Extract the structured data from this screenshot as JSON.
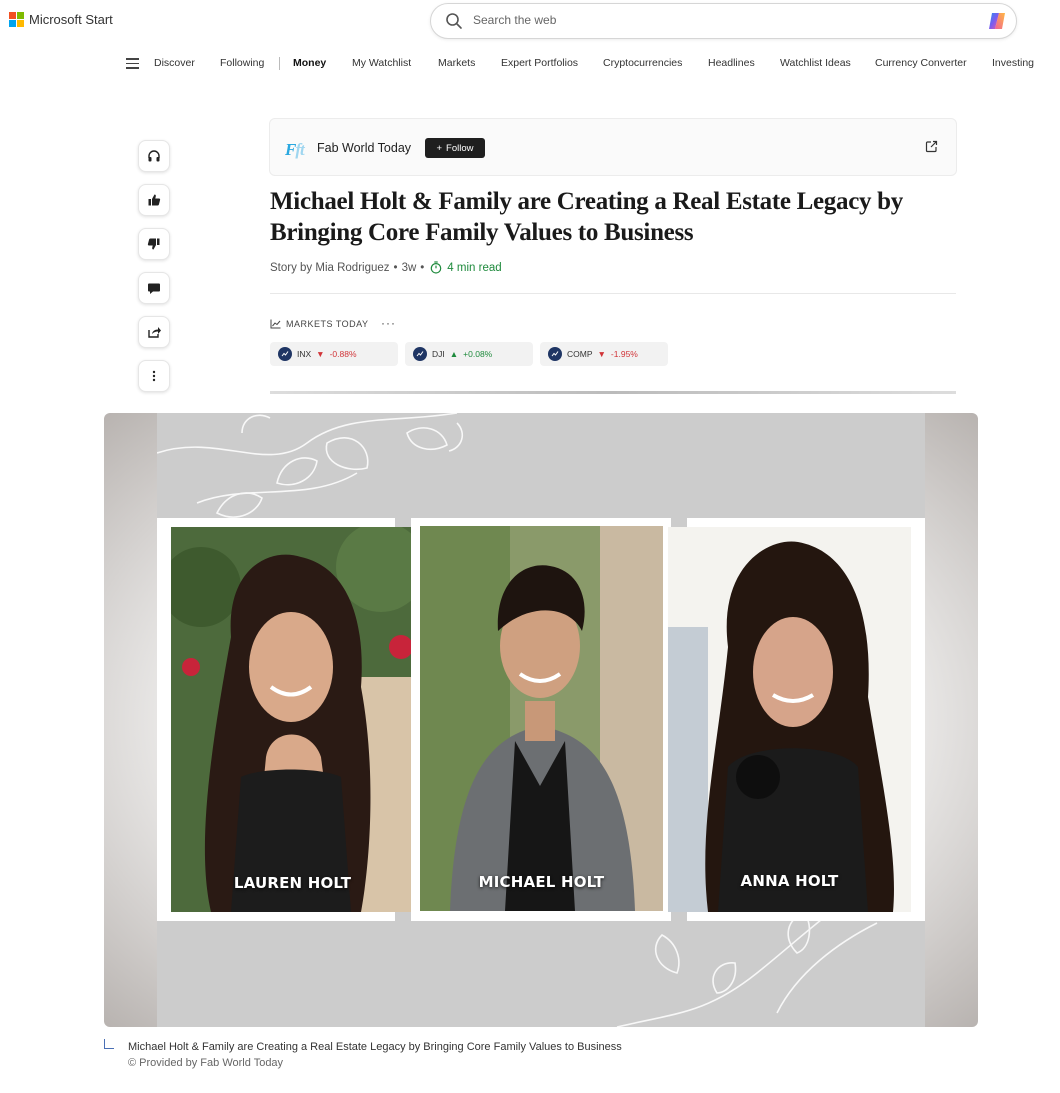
{
  "header": {
    "brand": "Microsoft Start",
    "search_placeholder": "Search the web"
  },
  "nav": {
    "items": [
      "Discover",
      "Following",
      "Money",
      "My Watchlist",
      "Markets",
      "Expert Portfolios",
      "Cryptocurrencies",
      "Headlines",
      "Watchlist Ideas",
      "Currency Converter",
      "Investing"
    ],
    "active": "Money"
  },
  "rail": {
    "buttons": [
      "headphones-icon",
      "thumbs-up-icon",
      "thumbs-down-icon",
      "comment-icon",
      "share-icon",
      "more-vertical-icon"
    ]
  },
  "publisher": {
    "logo_text": "F",
    "logo_text_2": "ft",
    "name": "Fab World Today",
    "follow_label": "Follow",
    "follow_plus": "+"
  },
  "article": {
    "headline": "Michael Holt & Family are Creating a Real Estate Legacy by Bringing Core Family Values to Business",
    "byline_prefix": "Story by Mia Rodriguez",
    "age": "3w",
    "read_time": "4 min read",
    "sep": "•"
  },
  "markets": {
    "label": "MARKETS TODAY",
    "more": "···",
    "tickers": [
      {
        "symbol": "INX",
        "change": "-0.88%",
        "direction": "down",
        "arrow": "▼"
      },
      {
        "symbol": "DJI",
        "change": "+0.08%",
        "direction": "up",
        "arrow": "▲"
      },
      {
        "symbol": "COMP",
        "change": "-1.95%",
        "direction": "down",
        "arrow": "▼"
      }
    ]
  },
  "image": {
    "people": [
      "LAUREN HOLT",
      "MICHAEL HOLT",
      "ANNA HOLT"
    ],
    "caption": "Michael Holt & Family are Creating a Real Estate Legacy by Bringing Core Family Values to Business",
    "credit": "© Provided by Fab World Today"
  },
  "colors": {
    "accent_green": "#1e8a3c",
    "down_red": "#d13438",
    "ticker_icon_bg": "#1f3564"
  }
}
